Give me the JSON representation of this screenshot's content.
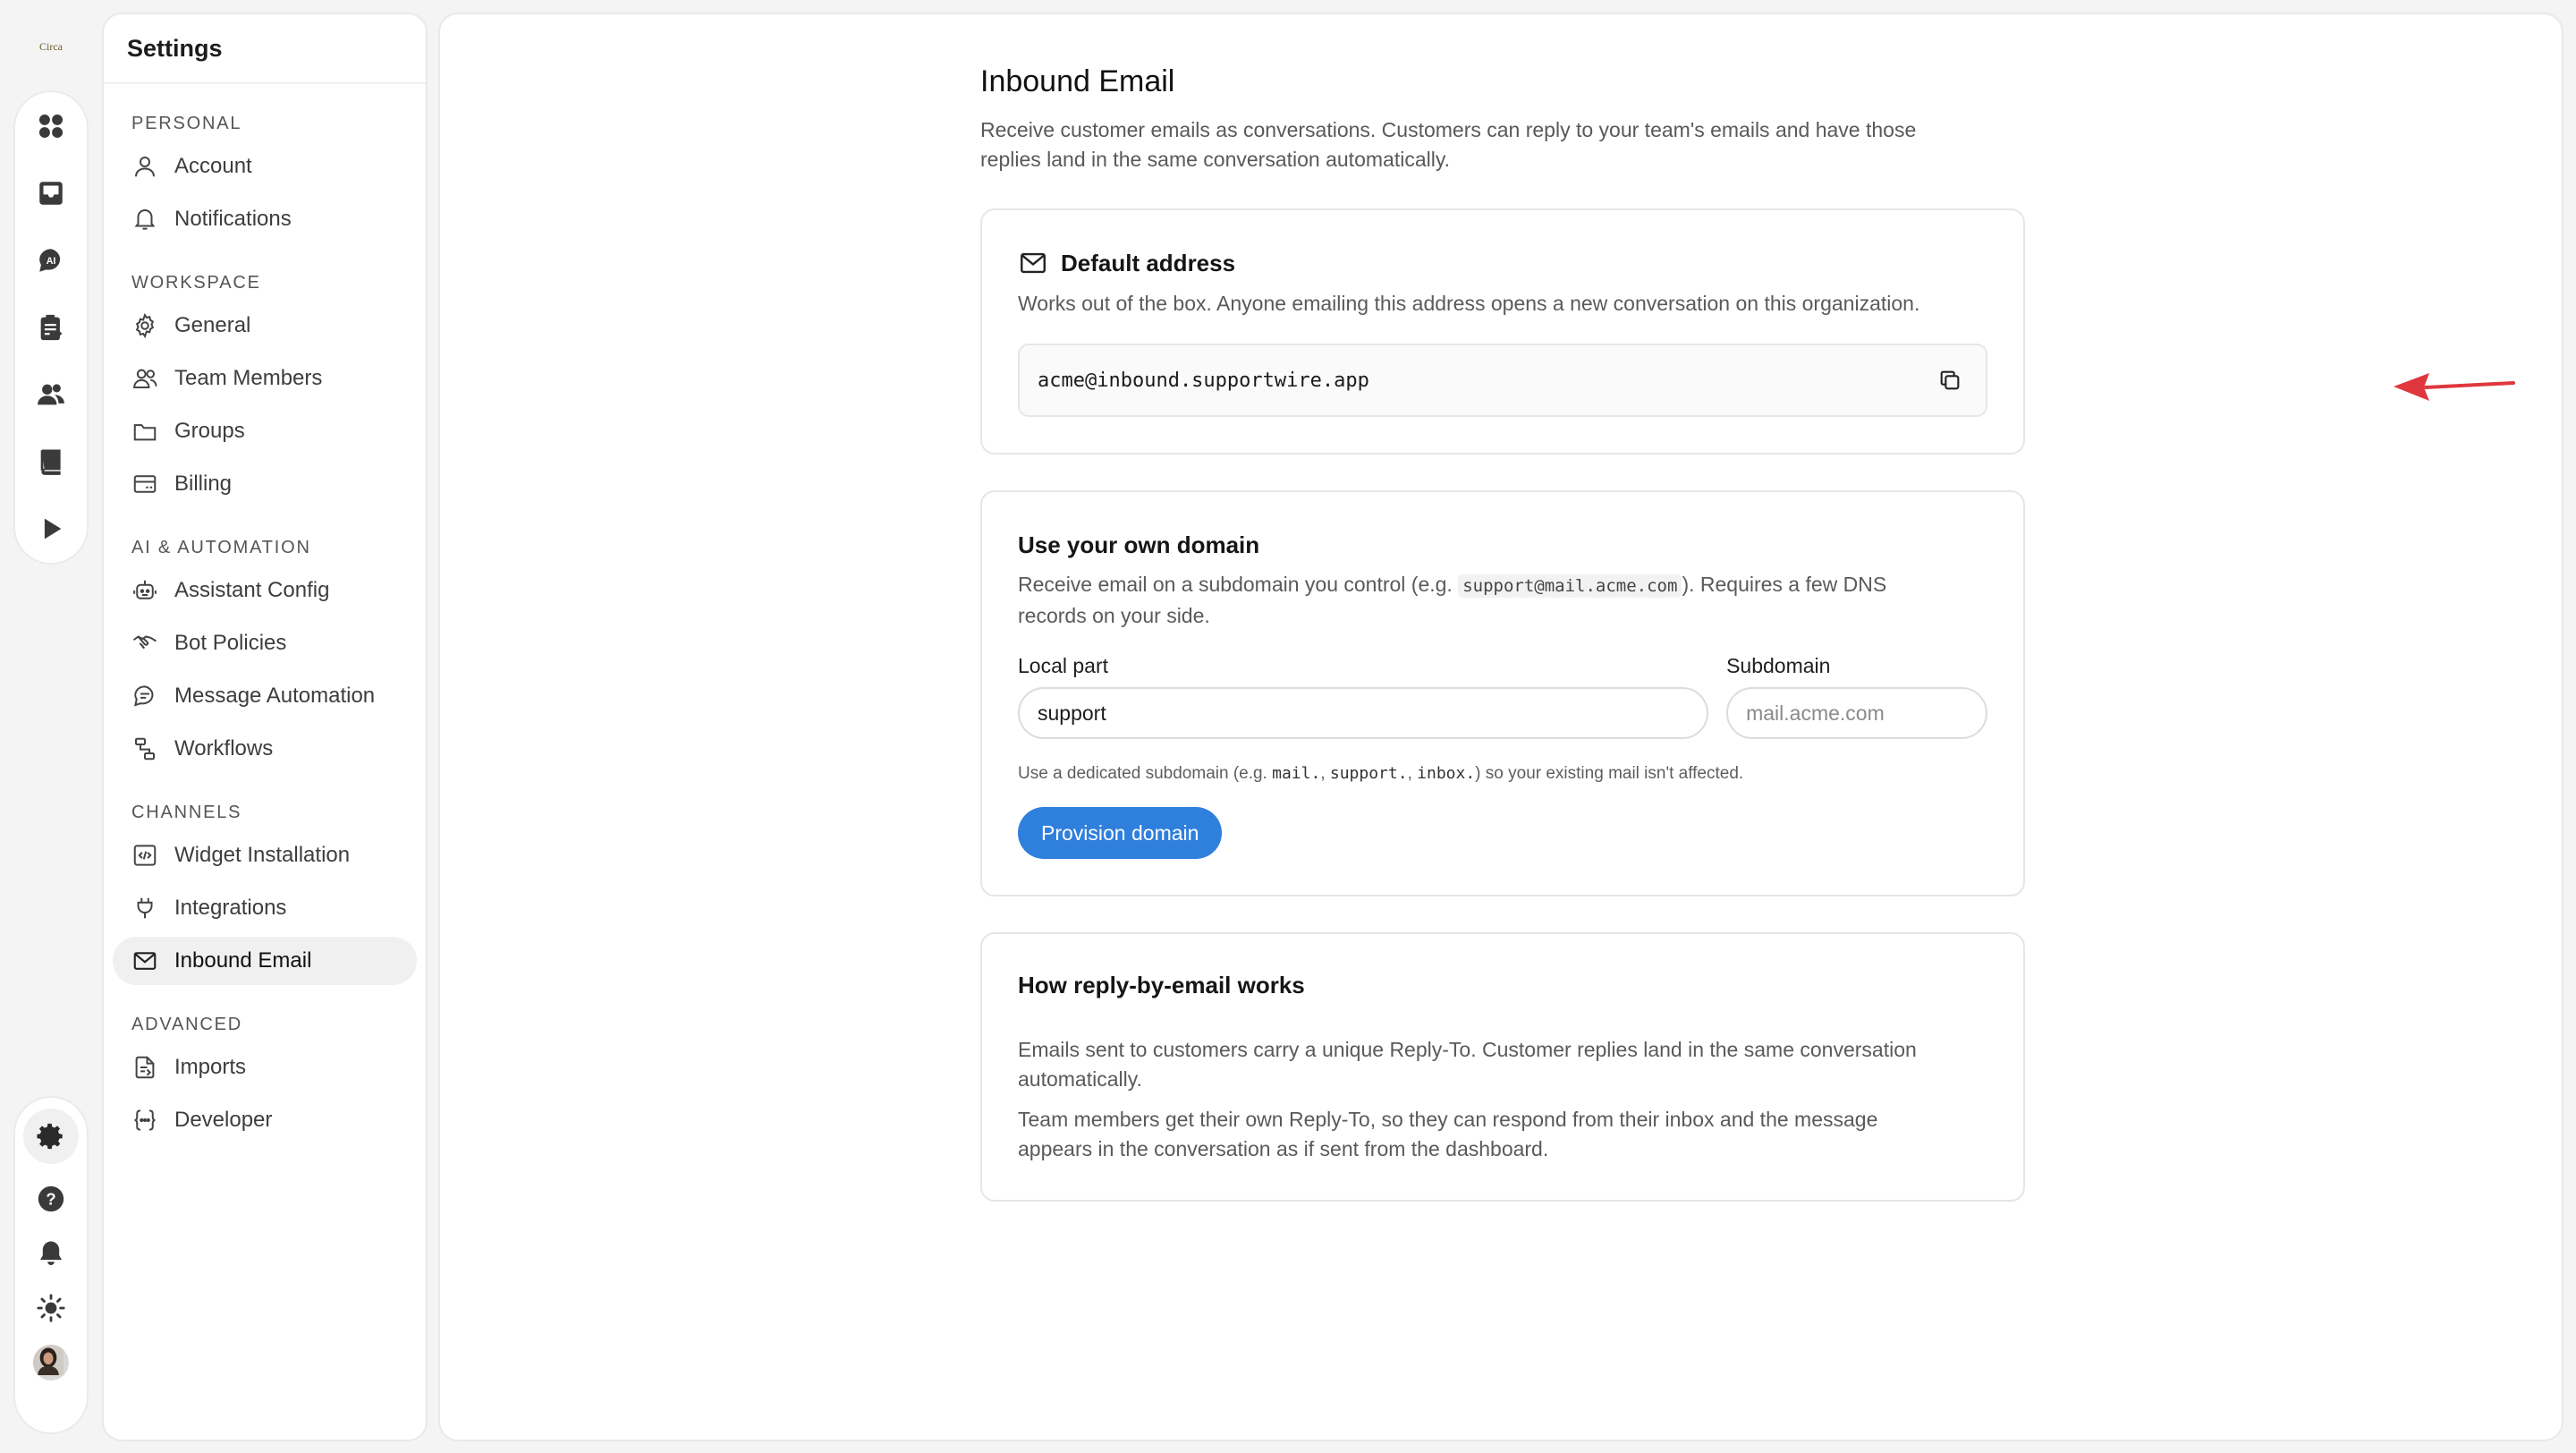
{
  "app": {
    "logo_text": "Circa"
  },
  "rail": {
    "top_items": [
      "grid-icon",
      "inbox-icon",
      "ai-chat-icon",
      "clipboard-check-icon",
      "users-icon",
      "book-icon",
      "play-icon"
    ],
    "bottom_items": [
      "gear-icon",
      "help-icon",
      "bell-icon",
      "sun-icon",
      "avatar"
    ]
  },
  "sidebar": {
    "title": "Settings",
    "sections": [
      {
        "label": "PERSONAL",
        "items": [
          {
            "label": "Account",
            "icon": "user-icon"
          },
          {
            "label": "Notifications",
            "icon": "bell-icon"
          }
        ]
      },
      {
        "label": "WORKSPACE",
        "items": [
          {
            "label": "General",
            "icon": "gear-icon"
          },
          {
            "label": "Team Members",
            "icon": "team-icon"
          },
          {
            "label": "Groups",
            "icon": "folder-icon"
          },
          {
            "label": "Billing",
            "icon": "card-icon"
          }
        ]
      },
      {
        "label": "AI & AUTOMATION",
        "items": [
          {
            "label": "Assistant Config",
            "icon": "bot-icon"
          },
          {
            "label": "Bot Policies",
            "icon": "handshake-icon"
          },
          {
            "label": "Message Automation",
            "icon": "message-icon"
          },
          {
            "label": "Workflows",
            "icon": "workflow-icon"
          }
        ]
      },
      {
        "label": "CHANNELS",
        "items": [
          {
            "label": "Widget Installation",
            "icon": "code-icon"
          },
          {
            "label": "Integrations",
            "icon": "plug-icon"
          },
          {
            "label": "Inbound Email",
            "icon": "mail-icon",
            "active": true
          }
        ]
      },
      {
        "label": "ADVANCED",
        "items": [
          {
            "label": "Imports",
            "icon": "import-icon"
          },
          {
            "label": "Developer",
            "icon": "braces-icon"
          }
        ]
      }
    ]
  },
  "page": {
    "title": "Inbound Email",
    "description": "Receive customer emails as conversations. Customers can reply to your team's emails and have those replies land in the same conversation automatically."
  },
  "default_address": {
    "title": "Default address",
    "description": "Works out of the box. Anyone emailing this address opens a new conversation on this organization.",
    "address": "acme@inbound.supportwire.app"
  },
  "own_domain": {
    "title": "Use your own domain",
    "description_before": "Receive email on a subdomain you control (e.g. ",
    "description_code": "support@mail.acme.com",
    "description_after": "). Requires a few DNS records on your side.",
    "local_part_label": "Local part",
    "local_part_value": "support",
    "subdomain_label": "Subdomain",
    "subdomain_placeholder": "mail.acme.com",
    "hint_before": "Use a dedicated subdomain (e.g. ",
    "hint_code_1": "mail.",
    "hint_sep_1": ", ",
    "hint_code_2": "support.",
    "hint_sep_2": ", ",
    "hint_code_3": "inbox.",
    "hint_after": ") so your existing mail isn't affected.",
    "button_label": "Provision domain"
  },
  "how_it_works": {
    "title": "How reply-by-email works",
    "paragraph_1": "Emails sent to customers carry a unique Reply-To. Customer replies land in the same conversation automatically.",
    "paragraph_2": "Team members get their own Reply-To, so they can respond from their inbox and the message appears in the conversation as if sent from the dashboard."
  },
  "colors": {
    "accent": "#2f7fdc",
    "annotation_arrow": "#e0373f"
  }
}
